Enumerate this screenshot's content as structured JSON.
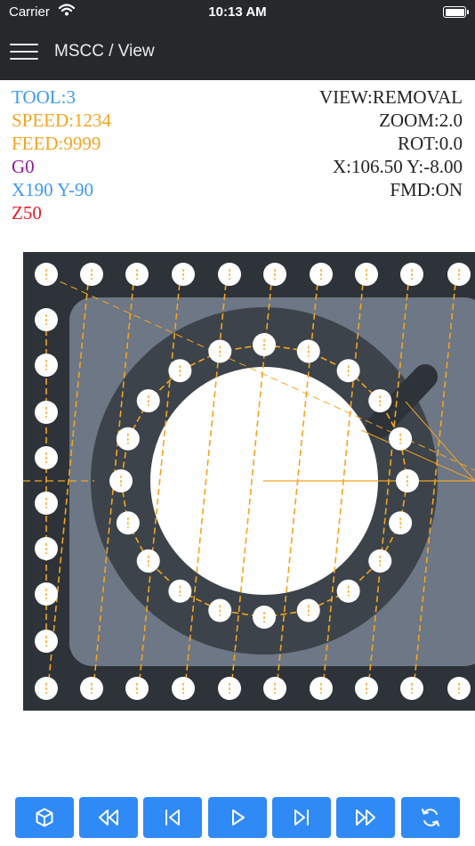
{
  "status_bar": {
    "carrier": "Carrier",
    "time": "10:13 AM"
  },
  "nav": {
    "title": "MSCC / View",
    "menu_icon": "hamburger-menu-icon"
  },
  "readout_left": [
    {
      "text": "TOOL:3",
      "color": "#3d9bf0"
    },
    {
      "text": "SPEED:1234",
      "color": "#f4a520"
    },
    {
      "text": "FEED:9999",
      "color": "#f4a520"
    },
    {
      "text": "G0",
      "color": "#8e1a9c"
    },
    {
      "text": "X190 Y-90",
      "color": "#3d9bf0"
    },
    {
      "text": "Z50",
      "color": "#ea1a2a"
    }
  ],
  "readout_right": [
    "VIEW:REMOVAL",
    "ZOOM:2.0",
    "ROT:0.0",
    "X:106.50 Y:-8.00",
    "FMD:ON"
  ],
  "colors": {
    "stock": "#2d3338",
    "plate": "#6d7785",
    "ring": "#3c434a",
    "hole": "#ffffff",
    "toolpath": "#f4a520",
    "tool": "#2d3338",
    "button": "#2f8af5"
  },
  "toolbar": {
    "buttons": [
      {
        "name": "view-3d-button",
        "icon": "cube-icon"
      },
      {
        "name": "rewind-button",
        "icon": "rewind-icon"
      },
      {
        "name": "skip-back-button",
        "icon": "skip-back-icon"
      },
      {
        "name": "play-button",
        "icon": "play-icon"
      },
      {
        "name": "skip-forward-button",
        "icon": "skip-forward-icon"
      },
      {
        "name": "fast-forward-button",
        "icon": "fast-forward-icon"
      },
      {
        "name": "reset-button",
        "icon": "refresh-icon"
      }
    ]
  }
}
